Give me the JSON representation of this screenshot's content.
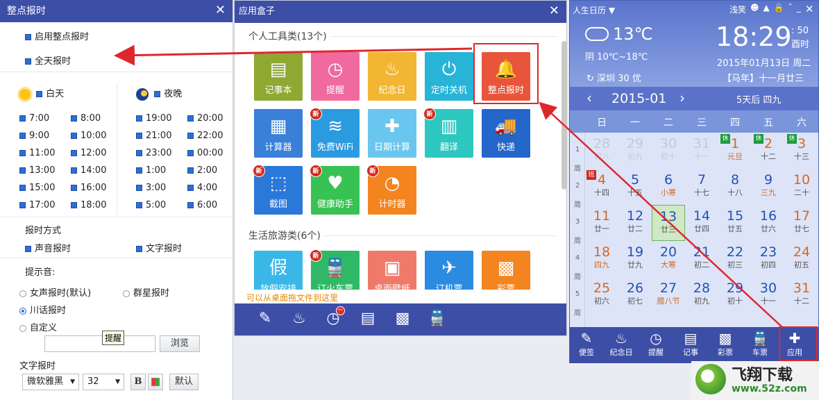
{
  "left_panel": {
    "title": "整点报时",
    "close": "✕",
    "enable": "启用整点报时",
    "allday": "全天报时",
    "day_label": "白天",
    "night_label": "夜晚",
    "day_times": [
      "7:00",
      "8:00",
      "9:00",
      "10:00",
      "11:00",
      "12:00",
      "13:00",
      "14:00",
      "15:00",
      "16:00",
      "17:00",
      "18:00"
    ],
    "night_times": [
      "19:00",
      "20:00",
      "21:00",
      "22:00",
      "23:00",
      "00:00",
      "1:00",
      "2:00",
      "3:00",
      "4:00",
      "5:00",
      "6:00"
    ],
    "mode_title": "报时方式",
    "voice": "声音报时",
    "text": "文字报时",
    "tone_title": "提示音:",
    "tone_female": "女声报时(默认)",
    "tone_group": "群星报时",
    "tone_sichuan": "川话报时",
    "tone_custom": "自定义",
    "browse": "浏览",
    "textreport_title": "文字报时",
    "font": "微软雅黑",
    "size": "32",
    "bold": "B",
    "default_btn": "默认"
  },
  "middle_panel": {
    "title": "应用盒子",
    "close": "✕",
    "cat1": "个人工具类(13个)",
    "cat2": "生活旅游类(6个)",
    "new": "新",
    "apps1": [
      {
        "name": "记事本",
        "icon": "notepad-icon",
        "glyph": "▤",
        "color": "#8ea832"
      },
      {
        "name": "提醒",
        "icon": "alarm-icon",
        "glyph": "◷",
        "color": "#f06aa0"
      },
      {
        "name": "纪念日",
        "icon": "cake-icon",
        "glyph": "♨",
        "color": "#f2b632"
      },
      {
        "name": "定时关机",
        "icon": "power-icon",
        "glyph": "⏻",
        "color": "#28b4d6"
      },
      {
        "name": "整点报时",
        "icon": "bell-icon",
        "glyph": "🔔",
        "color": "#e8553a"
      },
      {
        "name": "计算器",
        "icon": "calculator-icon",
        "glyph": "▦",
        "color": "#3a7fd8"
      },
      {
        "name": "免费WiFi",
        "icon": "wifi-icon",
        "glyph": "≋",
        "color": "#2b9be0"
      },
      {
        "name": "日期计算",
        "icon": "date-calc-icon",
        "glyph": "✚",
        "color": "#6ac6ee"
      },
      {
        "name": "翻译",
        "icon": "book-icon",
        "glyph": "▥",
        "color": "#2cc7c0"
      },
      {
        "name": "快递",
        "icon": "truck-icon",
        "glyph": "🚚",
        "color": "#2466c9"
      },
      {
        "name": "截图",
        "icon": "crop-icon",
        "glyph": "⬚",
        "color": "#2a78d8"
      },
      {
        "name": "健康助手",
        "icon": "health-icon",
        "glyph": "♥",
        "color": "#38c253"
      },
      {
        "name": "计时器",
        "icon": "stopwatch-icon",
        "glyph": "◔",
        "color": "#f48420"
      }
    ],
    "apps2": [
      {
        "name": "放假安排",
        "icon": "holiday-icon",
        "glyph": "假",
        "color": "#39b8e8"
      },
      {
        "name": "订火车票",
        "icon": "train-icon",
        "glyph": "🚆",
        "color": "#2fb966"
      },
      {
        "name": "桌面壁纸",
        "icon": "wallpaper-icon",
        "glyph": "▣",
        "color": "#f07a6a"
      },
      {
        "name": "订机票",
        "icon": "plane-icon",
        "glyph": "✈",
        "color": "#2b8be0"
      },
      {
        "name": "彩票",
        "icon": "lottery-icon",
        "glyph": "▩",
        "color": "#f48420"
      }
    ],
    "hint": "可以从桌面拖文件到这里",
    "tooltip": "提醒"
  },
  "calendar": {
    "title": "人生日历",
    "user": "浅笑",
    "temp": "13℃",
    "range": "阴 10℃~18℃",
    "city": "深圳 30 优",
    "time": "18:29",
    "seconds": ": 50",
    "period": "酉时",
    "date": "2015年01月13日 周二",
    "lunar": "【马年】十一月廿三",
    "month": "2015-01",
    "countdown": "5天后 四九",
    "weekdays": [
      "日",
      "一",
      "二",
      "三",
      "四",
      "五",
      "六"
    ],
    "week_nums": [
      "1",
      "2",
      "3",
      "4",
      "5"
    ],
    "zhou": "周",
    "hol": "休",
    "work": "班",
    "days": [
      [
        [
          "28",
          "初八"
        ],
        [
          "29",
          "初九"
        ],
        [
          "30",
          "初十"
        ],
        [
          "31",
          "十一"
        ],
        [
          "1",
          "元旦"
        ],
        [
          "2",
          "十二"
        ],
        [
          "3",
          "十三"
        ]
      ],
      [
        [
          "4",
          "十四"
        ],
        [
          "5",
          "十五"
        ],
        [
          "6",
          "小寒"
        ],
        [
          "7",
          "十七"
        ],
        [
          "8",
          "十八"
        ],
        [
          "9",
          "三九"
        ],
        [
          "10",
          "二十"
        ]
      ],
      [
        [
          "11",
          "廿一"
        ],
        [
          "12",
          "廿二"
        ],
        [
          "13",
          "廿三"
        ],
        [
          "14",
          "廿四"
        ],
        [
          "15",
          "廿五"
        ],
        [
          "16",
          "廿六"
        ],
        [
          "17",
          "廿七"
        ]
      ],
      [
        [
          "18",
          "四九"
        ],
        [
          "19",
          "廿九"
        ],
        [
          "20",
          "大寒"
        ],
        [
          "21",
          "初二"
        ],
        [
          "22",
          "初三"
        ],
        [
          "23",
          "初四"
        ],
        [
          "24",
          "初五"
        ]
      ],
      [
        [
          "25",
          "初六"
        ],
        [
          "26",
          "初七"
        ],
        [
          "27",
          "腊八节"
        ],
        [
          "28",
          "初九"
        ],
        [
          "29",
          "初十"
        ],
        [
          "30",
          "十一"
        ],
        [
          "31",
          "十二"
        ]
      ]
    ],
    "bottom": [
      {
        "label": "便签",
        "icon": "note-icon",
        "glyph": "✎"
      },
      {
        "label": "纪念日",
        "icon": "cake-icon",
        "glyph": "♨"
      },
      {
        "label": "提醒",
        "icon": "alarm-icon",
        "glyph": "◷"
      },
      {
        "label": "记事",
        "icon": "notepad-icon",
        "glyph": "▤"
      },
      {
        "label": "彩票",
        "icon": "lottery-icon",
        "glyph": "▩"
      },
      {
        "label": "车票",
        "icon": "train-icon",
        "glyph": "🚆"
      },
      {
        "label": "应用",
        "icon": "apps-icon",
        "glyph": "✚"
      }
    ]
  },
  "watermark": {
    "logo": "飞翔下载",
    "url": "www.52z.com"
  }
}
